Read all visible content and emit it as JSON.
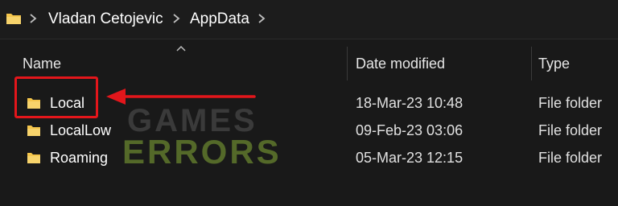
{
  "breadcrumb": {
    "items": [
      "Vladan Cetojevic",
      "AppData"
    ]
  },
  "columns": {
    "name": "Name",
    "date_modified": "Date modified",
    "type": "Type"
  },
  "rows": [
    {
      "name": "Local",
      "date": "18-Mar-23 10:48",
      "type": "File folder"
    },
    {
      "name": "LocalLow",
      "date": "09-Feb-23 03:06",
      "type": "File folder"
    },
    {
      "name": "Roaming",
      "date": "05-Mar-23 12:15",
      "type": "File folder"
    }
  ],
  "watermark": {
    "line1": "GAMES",
    "line2": "ERRORS"
  },
  "colors": {
    "folder": "#f4c54b",
    "highlight": "#e3161b",
    "watermark_green": "#5f782d"
  },
  "icons": {
    "folder": "folder-icon",
    "chevron": "chevron-right-icon",
    "sort": "sort-ascending-icon",
    "arrow": "arrow-left-icon"
  }
}
